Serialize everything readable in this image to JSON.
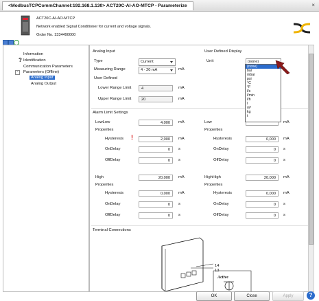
{
  "window": {
    "tab_title": "<ModbusTCPCommChannel:192.168.1.130> ACT20C-AI-AO-MTCP - Parameterize",
    "close_symbol": "×"
  },
  "device": {
    "name": "ACT20C-AI-AO-MTCP",
    "description": "Network enabled Signal Conditioner for current and voltage signals.",
    "order": "Order No. 1334490000"
  },
  "tree": {
    "items": [
      {
        "label": "Information"
      },
      {
        "label": "Identification"
      },
      {
        "label": "Communication Parameters"
      },
      {
        "label": "Parameters (Offline)"
      },
      {
        "label": "Analog Input"
      },
      {
        "label": "Analog Output"
      }
    ]
  },
  "analog_input": {
    "section_title": "Analog Input",
    "type_label": "Type",
    "type_value": "Current",
    "range_label": "Measuring Range",
    "range_value": "4 - 20 mA",
    "range_unit": "mA",
    "user_defined_label": "User Defined",
    "lower_label": "Lower Range Limit",
    "lower_value": "4",
    "lower_unit": "mA",
    "upper_label": "Upper Range Limit",
    "upper_value": "20",
    "upper_unit": "mA"
  },
  "display": {
    "section_title": "User Defined Display",
    "unit_label": "Unit",
    "unit_value": "(none)",
    "options": [
      "(none)",
      "bar",
      "mbar",
      "psi",
      "°C",
      "°F",
      "l/s",
      "l/min",
      "l/h",
      "l",
      "m³",
      "kg",
      "t"
    ]
  },
  "alarm": {
    "section_title": "Alarm Limit Settings",
    "properties_label": "Properties",
    "hysteresis_label": "Hysteresis",
    "ondelay_label": "OnDelay",
    "offdelay_label": "OffDelay",
    "warn_symbol": "!",
    "lowlow": {
      "label": "LowLow",
      "value": "4,000",
      "unit": "mA",
      "hysteresis": "2,000",
      "hys_unit": "mA",
      "ondelay": "0",
      "offdelay": "0",
      "sec": "s"
    },
    "low": {
      "label": "Low",
      "value": "",
      "unit": "mA",
      "hysteresis": "0,000",
      "hys_unit": "mA",
      "ondelay": "0",
      "offdelay": "0",
      "sec": "s"
    },
    "high": {
      "label": "High",
      "value": "20,000",
      "unit": "mA",
      "hysteresis": "0,000",
      "hys_unit": "mA",
      "ondelay": "0",
      "offdelay": "0",
      "sec": "s"
    },
    "highhigh": {
      "label": "HighHigh",
      "value": "20,000",
      "unit": "mA",
      "hysteresis": "0,000",
      "hys_unit": "mA",
      "ondelay": "0",
      "offdelay": "0",
      "sec": "s"
    }
  },
  "terminal": {
    "section_title": "Terminal Connections",
    "pin_a": "14",
    "pin_b": "13",
    "active_label": "Active"
  },
  "buttons": {
    "ok": "OK",
    "close": "Close",
    "apply": "Apply",
    "help": "?"
  },
  "colors": {
    "accent": "#2b6ccc",
    "warning": "#d40000",
    "logo": "#222222",
    "logo_accent": "#f0b400"
  }
}
